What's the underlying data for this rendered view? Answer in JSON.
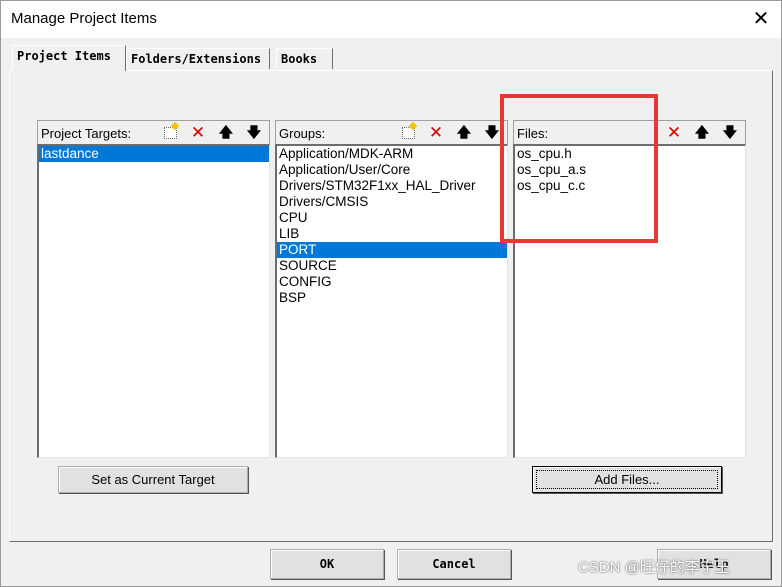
{
  "window": {
    "title": "Manage Project Items",
    "close_glyph": "✕"
  },
  "tabs": [
    {
      "label": "Project Items",
      "active": true
    },
    {
      "label": "Folders/Extensions",
      "active": false
    },
    {
      "label": "Books",
      "active": false
    }
  ],
  "targets_pane": {
    "label": "Project Targets:",
    "items": [
      {
        "text": "lastdance",
        "selected": true
      }
    ],
    "toolbar": [
      "new-icon",
      "delete-icon",
      "move-up-icon",
      "move-down-icon"
    ]
  },
  "groups_pane": {
    "label": "Groups:",
    "items": [
      {
        "text": "Application/MDK-ARM",
        "selected": false
      },
      {
        "text": "Application/User/Core",
        "selected": false
      },
      {
        "text": "Drivers/STM32F1xx_HAL_Driver",
        "selected": false
      },
      {
        "text": "Drivers/CMSIS",
        "selected": false
      },
      {
        "text": "CPU",
        "selected": false
      },
      {
        "text": "LIB",
        "selected": false
      },
      {
        "text": "PORT",
        "selected": true
      },
      {
        "text": "SOURCE",
        "selected": false
      },
      {
        "text": "CONFIG",
        "selected": false
      },
      {
        "text": "BSP",
        "selected": false
      }
    ],
    "toolbar": [
      "new-icon",
      "delete-icon",
      "move-up-icon",
      "move-down-icon"
    ]
  },
  "files_pane": {
    "label": "Files:",
    "items": [
      {
        "text": "os_cpu.h",
        "selected": false
      },
      {
        "text": "os_cpu_a.s",
        "selected": false
      },
      {
        "text": "os_cpu_c.c",
        "selected": false
      }
    ],
    "toolbar": [
      "delete-icon",
      "move-up-icon",
      "move-down-icon"
    ]
  },
  "buttons": {
    "set_target": "Set as Current Target",
    "add_files": "Add Files...",
    "ok": "OK",
    "cancel": "Cancel",
    "help": "Help"
  },
  "glyphs": {
    "delete": "✕",
    "up": "🡅",
    "down": "🡇"
  },
  "watermark": "CSDN @旺仔的李宁玉",
  "colors": {
    "selection": "#0078d7",
    "highlight_box": "#e53935",
    "delete_icon": "#d40000"
  }
}
